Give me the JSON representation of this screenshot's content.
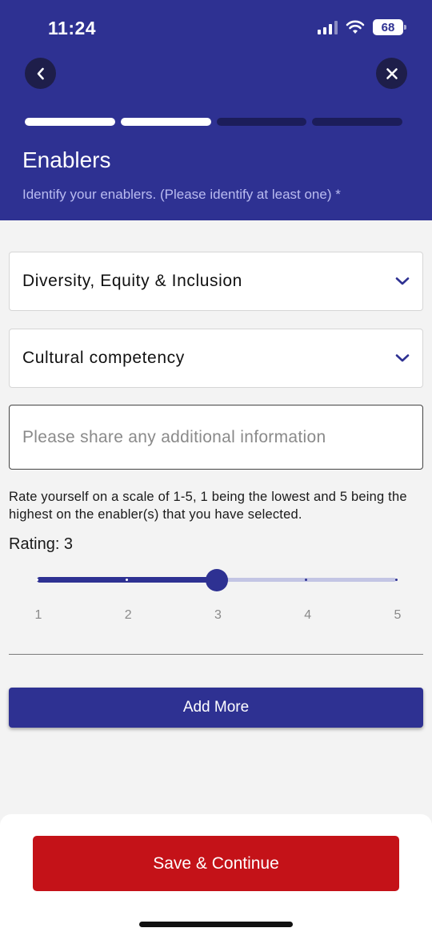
{
  "status_bar": {
    "time": "11:24",
    "battery": "68"
  },
  "header": {
    "title": "Enablers",
    "subtitle": "Identify your enablers. (Please identify at least one) *",
    "progress": {
      "completed_steps": 2,
      "total_steps": 4
    }
  },
  "form": {
    "enabler_1": "Diversity, Equity & Inclusion",
    "enabler_2": "Cultural competency",
    "additional_info_placeholder": "Please share any additional information",
    "rating_instructions": "Rate yourself on a scale of 1-5, 1 being the lowest and 5 being the highest on the enabler(s) that you have selected.",
    "rating_label": "Rating: 3",
    "rating": {
      "value": 3,
      "min": 1,
      "max": 5,
      "ticks": [
        "1",
        "2",
        "3",
        "4",
        "5"
      ]
    },
    "add_more_label": "Add More"
  },
  "footer": {
    "save_label": "Save & Continue"
  },
  "colors": {
    "primary": "#2e3192",
    "primary_dark": "#1c1d5a",
    "accent_red": "#c41218",
    "background": "#f3f3f3"
  },
  "icons": [
    "back-chevron",
    "close-x",
    "chevron-down",
    "cellular-signal",
    "wifi",
    "battery"
  ]
}
